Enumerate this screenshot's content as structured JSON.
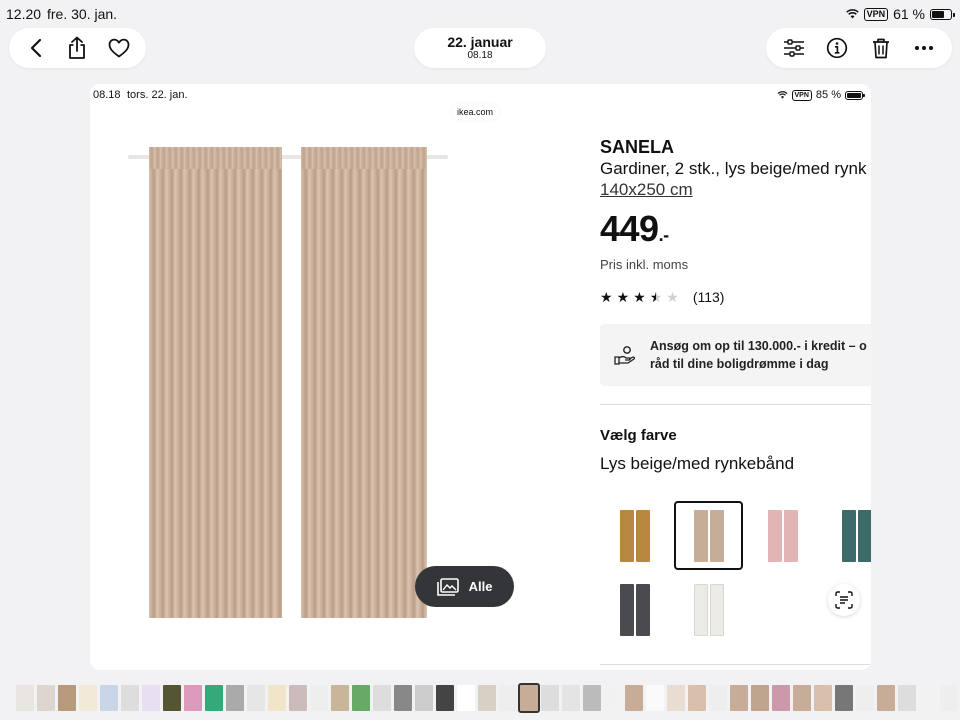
{
  "status": {
    "time": "12.20",
    "date": "fre. 30. jan.",
    "vpn": "VPN",
    "battery": "61 %",
    "battery_level": 0.61
  },
  "viewer": {
    "date_title": "22. januar",
    "time_subtitle": "08.18"
  },
  "screenshot": {
    "status": {
      "time": "08.18",
      "date": "tors. 22. jan.",
      "vpn": "VPN",
      "battery": "85 %",
      "battery_level": 0.85
    },
    "url": "ikea.com",
    "gallery_button": "Alle",
    "product": {
      "name": "SANELA",
      "description": "Gardiner, 2 stk., lys beige/med rynk",
      "size": "140x250 cm",
      "price": "449",
      "price_suffix": ".-",
      "price_note": "Pris inkl. moms",
      "rating": 3.5,
      "reviews": "(113)",
      "credit_text_1": "Ansøg om op til 130.000.- i kredit – o",
      "credit_text_2": "råd til dine boligdrømme i dag",
      "choose_color_label": "Vælg farve",
      "selected_color": "Lys beige/med rynkebånd",
      "swatches": [
        {
          "name": "gold-brown",
          "color": "#b8873f",
          "selected": false
        },
        {
          "name": "light-beige",
          "color": "#c7ad98",
          "selected": true
        },
        {
          "name": "pink",
          "color": "#e2b4b4",
          "selected": false
        },
        {
          "name": "dark-turquoise",
          "color": "#3c6b6a",
          "selected": false
        },
        {
          "name": "dark-grey",
          "color": "#4a4b4e",
          "selected": false
        },
        {
          "name": "white",
          "color": "#ecebe6",
          "selected": false
        }
      ]
    }
  }
}
